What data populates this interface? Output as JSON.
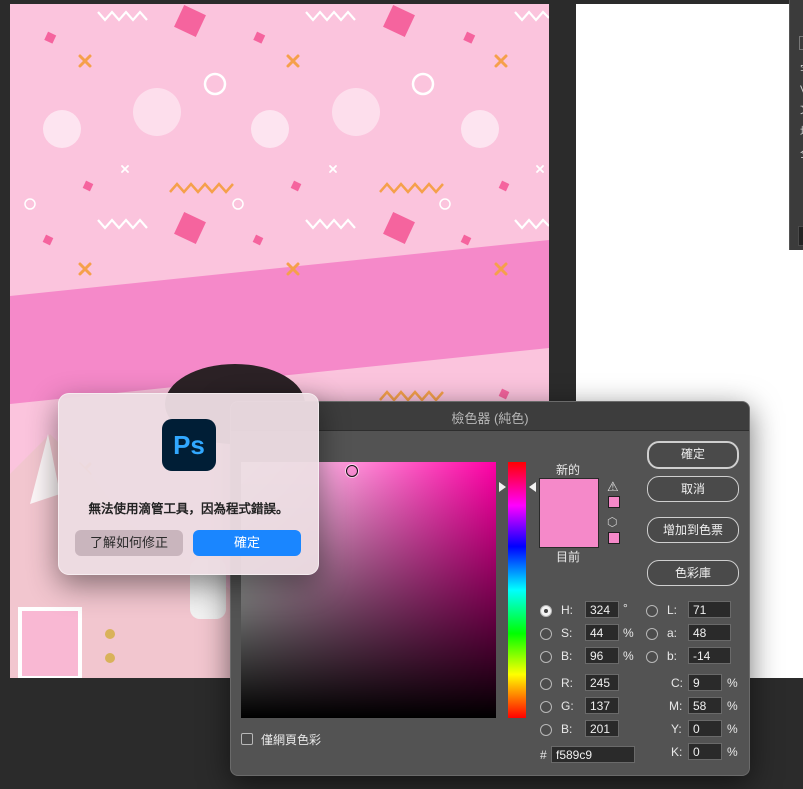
{
  "picker": {
    "title": "檢色器 (純色)",
    "new_label": "新的",
    "current_label": "目前",
    "buttons": {
      "ok": "確定",
      "cancel": "取消",
      "add_swatch": "增加到色票",
      "libraries": "色彩庫"
    },
    "hsb": {
      "h_label": "H:",
      "h_value": "324",
      "h_unit": "°",
      "s_label": "S:",
      "s_value": "44",
      "s_unit": "%",
      "b_label": "B:",
      "b_value": "96",
      "b_unit": "%"
    },
    "rgb": {
      "r_label": "R:",
      "r_value": "245",
      "g_label": "G:",
      "g_value": "137",
      "b_label": "B:",
      "b_value": "201"
    },
    "lab": {
      "l_label": "L:",
      "l_value": "71",
      "a_label": "a:",
      "a_value": "48",
      "b_label": "b:",
      "b_value": "-14"
    },
    "cmyk": {
      "c_label": "C:",
      "c_value": "9",
      "c_unit": "%",
      "m_label": "M:",
      "m_value": "58",
      "m_unit": "%",
      "y_label": "Y:",
      "y_value": "0",
      "y_unit": "%",
      "k_label": "K:",
      "k_value": "0",
      "k_unit": "%"
    },
    "hex_label": "#",
    "hex_value": "f589c9",
    "web_only_label": "僅網頁色彩",
    "colors": {
      "selected": "#f589c9",
      "hue_pure": "#ff00a6"
    }
  },
  "alert": {
    "app_icon_text": "Ps",
    "message": "無法使用滴管工具，因為程式錯誤。",
    "learn_fix_button": "了解如何修正",
    "ok_button": "確定"
  },
  "canvas": {
    "background_color": "#fbc4dd",
    "band_color": "#f589c9",
    "accent_pink": "#f5649e",
    "accent_orange": "#f5a04b"
  }
}
